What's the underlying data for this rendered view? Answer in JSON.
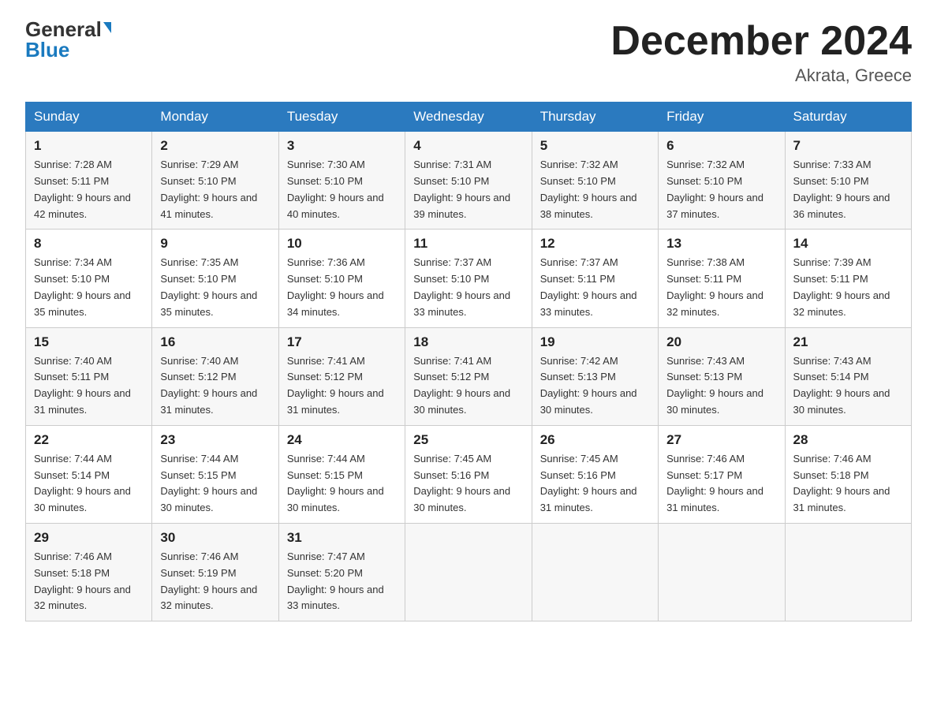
{
  "logo": {
    "general": "General",
    "blue": "Blue"
  },
  "title": "December 2024",
  "location": "Akrata, Greece",
  "days_of_week": [
    "Sunday",
    "Monday",
    "Tuesday",
    "Wednesday",
    "Thursday",
    "Friday",
    "Saturday"
  ],
  "weeks": [
    [
      {
        "day": "1",
        "sunrise": "7:28 AM",
        "sunset": "5:11 PM",
        "daylight": "9 hours and 42 minutes."
      },
      {
        "day": "2",
        "sunrise": "7:29 AM",
        "sunset": "5:10 PM",
        "daylight": "9 hours and 41 minutes."
      },
      {
        "day": "3",
        "sunrise": "7:30 AM",
        "sunset": "5:10 PM",
        "daylight": "9 hours and 40 minutes."
      },
      {
        "day": "4",
        "sunrise": "7:31 AM",
        "sunset": "5:10 PM",
        "daylight": "9 hours and 39 minutes."
      },
      {
        "day": "5",
        "sunrise": "7:32 AM",
        "sunset": "5:10 PM",
        "daylight": "9 hours and 38 minutes."
      },
      {
        "day": "6",
        "sunrise": "7:32 AM",
        "sunset": "5:10 PM",
        "daylight": "9 hours and 37 minutes."
      },
      {
        "day": "7",
        "sunrise": "7:33 AM",
        "sunset": "5:10 PM",
        "daylight": "9 hours and 36 minutes."
      }
    ],
    [
      {
        "day": "8",
        "sunrise": "7:34 AM",
        "sunset": "5:10 PM",
        "daylight": "9 hours and 35 minutes."
      },
      {
        "day": "9",
        "sunrise": "7:35 AM",
        "sunset": "5:10 PM",
        "daylight": "9 hours and 35 minutes."
      },
      {
        "day": "10",
        "sunrise": "7:36 AM",
        "sunset": "5:10 PM",
        "daylight": "9 hours and 34 minutes."
      },
      {
        "day": "11",
        "sunrise": "7:37 AM",
        "sunset": "5:10 PM",
        "daylight": "9 hours and 33 minutes."
      },
      {
        "day": "12",
        "sunrise": "7:37 AM",
        "sunset": "5:11 PM",
        "daylight": "9 hours and 33 minutes."
      },
      {
        "day": "13",
        "sunrise": "7:38 AM",
        "sunset": "5:11 PM",
        "daylight": "9 hours and 32 minutes."
      },
      {
        "day": "14",
        "sunrise": "7:39 AM",
        "sunset": "5:11 PM",
        "daylight": "9 hours and 32 minutes."
      }
    ],
    [
      {
        "day": "15",
        "sunrise": "7:40 AM",
        "sunset": "5:11 PM",
        "daylight": "9 hours and 31 minutes."
      },
      {
        "day": "16",
        "sunrise": "7:40 AM",
        "sunset": "5:12 PM",
        "daylight": "9 hours and 31 minutes."
      },
      {
        "day": "17",
        "sunrise": "7:41 AM",
        "sunset": "5:12 PM",
        "daylight": "9 hours and 31 minutes."
      },
      {
        "day": "18",
        "sunrise": "7:41 AM",
        "sunset": "5:12 PM",
        "daylight": "9 hours and 30 minutes."
      },
      {
        "day": "19",
        "sunrise": "7:42 AM",
        "sunset": "5:13 PM",
        "daylight": "9 hours and 30 minutes."
      },
      {
        "day": "20",
        "sunrise": "7:43 AM",
        "sunset": "5:13 PM",
        "daylight": "9 hours and 30 minutes."
      },
      {
        "day": "21",
        "sunrise": "7:43 AM",
        "sunset": "5:14 PM",
        "daylight": "9 hours and 30 minutes."
      }
    ],
    [
      {
        "day": "22",
        "sunrise": "7:44 AM",
        "sunset": "5:14 PM",
        "daylight": "9 hours and 30 minutes."
      },
      {
        "day": "23",
        "sunrise": "7:44 AM",
        "sunset": "5:15 PM",
        "daylight": "9 hours and 30 minutes."
      },
      {
        "day": "24",
        "sunrise": "7:44 AM",
        "sunset": "5:15 PM",
        "daylight": "9 hours and 30 minutes."
      },
      {
        "day": "25",
        "sunrise": "7:45 AM",
        "sunset": "5:16 PM",
        "daylight": "9 hours and 30 minutes."
      },
      {
        "day": "26",
        "sunrise": "7:45 AM",
        "sunset": "5:16 PM",
        "daylight": "9 hours and 31 minutes."
      },
      {
        "day": "27",
        "sunrise": "7:46 AM",
        "sunset": "5:17 PM",
        "daylight": "9 hours and 31 minutes."
      },
      {
        "day": "28",
        "sunrise": "7:46 AM",
        "sunset": "5:18 PM",
        "daylight": "9 hours and 31 minutes."
      }
    ],
    [
      {
        "day": "29",
        "sunrise": "7:46 AM",
        "sunset": "5:18 PM",
        "daylight": "9 hours and 32 minutes."
      },
      {
        "day": "30",
        "sunrise": "7:46 AM",
        "sunset": "5:19 PM",
        "daylight": "9 hours and 32 minutes."
      },
      {
        "day": "31",
        "sunrise": "7:47 AM",
        "sunset": "5:20 PM",
        "daylight": "9 hours and 33 minutes."
      },
      null,
      null,
      null,
      null
    ]
  ]
}
